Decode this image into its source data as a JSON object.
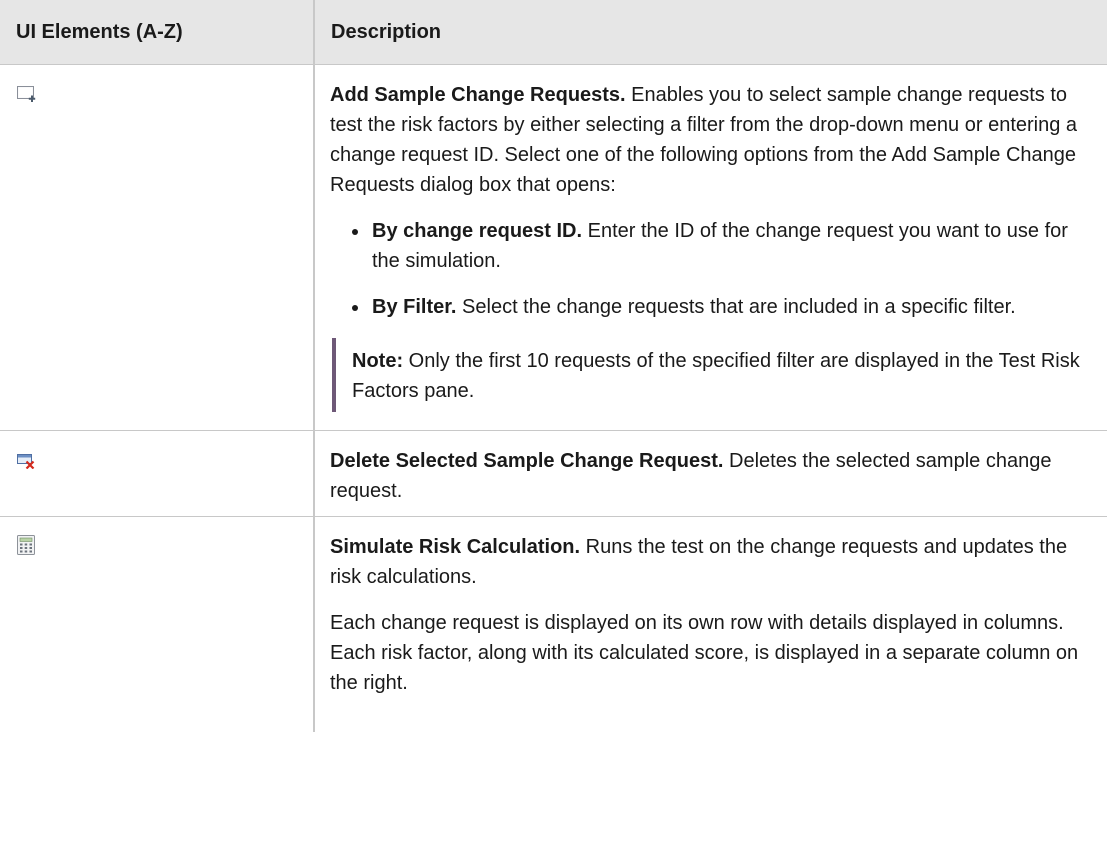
{
  "header": {
    "col1": "UI Elements (A-Z)",
    "col2": "Description"
  },
  "rows": [
    {
      "icon": "add-sample-icon",
      "title": "Add Sample Change Requests.",
      "text": " Enables you to select sample change requests to test the risk factors by either selecting a filter from the drop-down menu or entering a change request ID. Select one of the following options from the Add Sample Change Requests dialog box that opens:",
      "options": [
        {
          "title": "By change request ID.",
          "text": " Enter the ID of the change request you want to use for the simulation."
        },
        {
          "title": "By Filter.",
          "text": " Select the change requests that are included in a specific filter."
        }
      ],
      "note": {
        "label": "Note:",
        "text": " Only the first 10 requests of the specified filter are displayed in the Test Risk Factors pane."
      }
    },
    {
      "icon": "delete-sample-icon",
      "title": "Delete Selected Sample Change Request.",
      "text": " Deletes the selected sample change request."
    },
    {
      "icon": "calculator-icon",
      "title": "Simulate Risk Calculation.",
      "text": " Runs the test on the change requests and updates the risk calculations.",
      "extra": "Each change request is displayed on its own row with details displayed in columns. Each risk factor, along with its calculated score, is displayed in a separate column on the right."
    }
  ]
}
